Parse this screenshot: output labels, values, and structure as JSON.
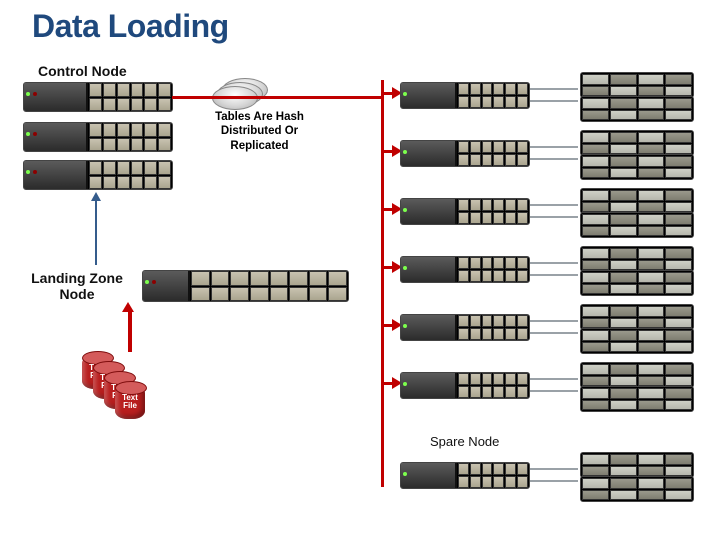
{
  "title": "Data Loading",
  "labels": {
    "control_node": "Control Node",
    "landing_zone_node": "Landing Zone\nNode",
    "spare_node": "Spare Node"
  },
  "caption": {
    "line1": "Tables Are Hash",
    "line2": "Distributed Or",
    "line3": "Replicated"
  },
  "cylinder_text": "Text File"
}
